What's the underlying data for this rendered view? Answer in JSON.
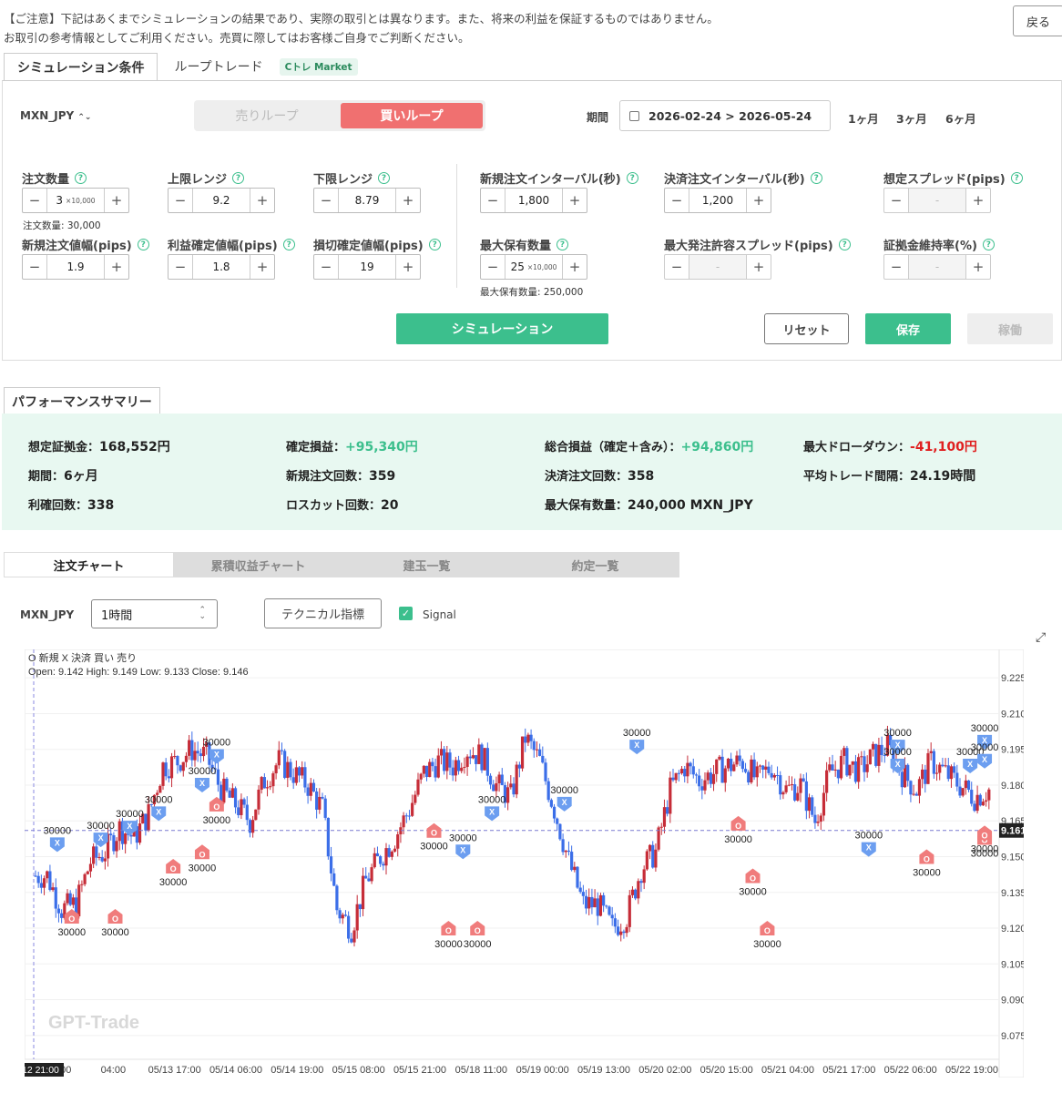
{
  "notice": {
    "line1": "【ご注意】下記はあくまでシミュレーションの結果であり、実際の取引とは異なります。また、将来の利益を保証するものではありません。",
    "line2": "お取引の参考情報としてご利用ください。売買に際してはお客様ご自身でご判断ください。"
  },
  "back_label": "戻る",
  "top_tabs": {
    "conditions": "シミュレーション条件",
    "loop": "ループトレード",
    "ctre": "Cトレ Market"
  },
  "form": {
    "pair": "MXN_JPY",
    "sell_loop": "売りループ",
    "buy_loop": "買いループ",
    "period_label": "期間",
    "date_range": "2026-02-24 > 2026-05-24",
    "ranges": [
      "1ヶ月",
      "3ヶ月",
      "6ヶ月"
    ],
    "fields": {
      "order_qty": {
        "label": "注文数量",
        "value": "3",
        "unit": "×10,000",
        "hint": "注文数量: 30,000"
      },
      "upper": {
        "label": "上限レンジ",
        "value": "9.2"
      },
      "lower": {
        "label": "下限レンジ",
        "value": "8.79"
      },
      "new_interval": {
        "label": "新規注文インターバル(秒)",
        "value": "1,800"
      },
      "close_interval": {
        "label": "決済注文インターバル(秒)",
        "value": "1,200"
      },
      "spread": {
        "label": "想定スプレッド(pips)",
        "value": "-"
      },
      "new_width": {
        "label": "新規注文値幅(pips)",
        "value": "1.9"
      },
      "profit_width": {
        "label": "利益確定値幅(pips)",
        "value": "1.8"
      },
      "stop_width": {
        "label": "損切確定値幅(pips)",
        "value": "19"
      },
      "max_hold": {
        "label": "最大保有数量",
        "value": "25",
        "unit": "×10,000",
        "hint": "最大保有数量: 250,000"
      },
      "max_spread": {
        "label": "最大発注許容スプレッド(pips)",
        "value": "-"
      },
      "margin_rate": {
        "label": "証拠金維持率(%)",
        "value": "-"
      }
    },
    "simulate": "シミュレーション",
    "reset": "リセット",
    "save": "保存",
    "run": "稼働"
  },
  "summary": {
    "tab": "パフォーマンスサマリー",
    "margin_label": "想定証拠金：",
    "margin": "168,552円",
    "realized_label": "確定損益：",
    "realized": "+95,340円",
    "total_label": "総合損益（確定＋含み）：",
    "total": "+94,860円",
    "dd_label": "最大ドローダウン：",
    "dd": "-41,100円",
    "period_label": "期間：",
    "period": "6ヶ月",
    "new_count_label": "新規注文回数：",
    "new_count": "359",
    "close_count_label": "決済注文回数：",
    "close_count": "358",
    "interval_label": "平均トレード間隔：",
    "interval": "24.19時間",
    "win_label": "利確回数：",
    "win": "338",
    "loss_label": "ロスカット回数：",
    "loss": "20",
    "maxhold_label": "最大保有数量：",
    "maxhold": "240,000 MXN_JPY"
  },
  "chart_tabs": [
    "注文チャート",
    "累積収益チャート",
    "建玉一覧",
    "約定一覧"
  ],
  "chart_controls": {
    "pair": "MXN_JPY",
    "timeframe": "1時間",
    "technical": "テクニカル指標",
    "signal": "Signal"
  },
  "chart_data": {
    "type": "candlestick",
    "legend": "O 新規  X 決済  買い  売り",
    "ohlc_readout": "Open: 9.142  High: 9.149  Low: 9.133  Close: 9.146",
    "ylim": [
      9.065,
      9.235
    ],
    "y_ticks": [
      "9.225",
      "9.210",
      "9.195",
      "9.180",
      "9.165",
      "9.150",
      "9.135",
      "9.120",
      "9.105",
      "9.090",
      "9.075"
    ],
    "x_ticks": [
      "12 21:00",
      "04:00",
      "05/13 17:00",
      "05/14 06:00",
      "05/14 19:00",
      "05/15 08:00",
      "05/15 21:00",
      "05/18 11:00",
      "05/19 00:00",
      "05/19 13:00",
      "05/20 02:00",
      "05/20 15:00",
      "05/21 04:00",
      "05/21 17:00",
      "05/22 06:00",
      "05/22 19:00"
    ],
    "current_price": "9.161",
    "watermark": "GPT-Trade",
    "close_path": [
      9.142,
      9.128,
      9.13,
      9.148,
      9.152,
      9.162,
      9.158,
      9.168,
      9.188,
      9.19,
      9.195,
      9.192,
      9.178,
      9.172,
      9.165,
      9.182,
      9.19,
      9.185,
      9.18,
      9.17,
      9.128,
      9.12,
      9.14,
      9.15,
      9.158,
      9.17,
      9.185,
      9.19,
      9.188,
      9.195,
      9.192,
      9.18,
      9.175,
      9.2,
      9.19,
      9.17,
      9.148,
      9.13,
      9.13,
      9.12,
      9.125,
      9.145,
      9.152,
      9.178,
      9.188,
      9.182,
      9.185,
      9.188,
      9.19,
      9.182,
      9.188,
      9.178,
      9.18,
      9.165,
      9.185,
      9.19,
      9.186,
      9.192,
      9.196,
      9.185,
      9.178,
      9.19,
      9.185,
      9.18,
      9.175,
      9.178
    ],
    "signals": [
      {
        "kind": "X",
        "side": "sell",
        "qty": "30000",
        "i": 1,
        "price": 9.155
      },
      {
        "kind": "O",
        "side": "buy",
        "qty": "30000",
        "i": 2,
        "price": 9.125
      },
      {
        "kind": "X",
        "side": "sell",
        "qty": "30000",
        "i": 4,
        "price": 9.157
      },
      {
        "kind": "O",
        "side": "buy",
        "qty": "30000",
        "i": 5,
        "price": 9.125
      },
      {
        "kind": "X",
        "side": "sell",
        "qty": "30000",
        "i": 6,
        "price": 9.162
      },
      {
        "kind": "X",
        "side": "sell",
        "qty": "30000",
        "i": 8,
        "price": 9.168
      },
      {
        "kind": "O",
        "side": "buy",
        "qty": "30000",
        "i": 9,
        "price": 9.146
      },
      {
        "kind": "O",
        "side": "buy",
        "qty": "30000",
        "i": 11,
        "price": 9.152
      },
      {
        "kind": "X",
        "side": "sell",
        "qty": "30000",
        "i": 11,
        "price": 9.18
      },
      {
        "kind": "X",
        "side": "sell",
        "qty": "30000",
        "i": 12,
        "price": 9.192
      },
      {
        "kind": "O",
        "side": "buy",
        "qty": "30000",
        "i": 12,
        "price": 9.172
      },
      {
        "kind": "O",
        "side": "buy",
        "qty": "30000",
        "i": 27,
        "price": 9.161
      },
      {
        "kind": "O",
        "side": "buy",
        "qty": "30000",
        "i": 28,
        "price": 9.12
      },
      {
        "kind": "X",
        "side": "sell",
        "qty": "30000",
        "i": 29,
        "price": 9.152
      },
      {
        "kind": "O",
        "side": "buy",
        "qty": "30000",
        "i": 30,
        "price": 9.12
      },
      {
        "kind": "X",
        "side": "sell",
        "qty": "30000",
        "i": 31,
        "price": 9.168
      },
      {
        "kind": "X",
        "side": "sell",
        "qty": "30000",
        "i": 36,
        "price": 9.172
      },
      {
        "kind": "X",
        "side": "sell",
        "qty": "30000",
        "i": 41,
        "price": 9.196
      },
      {
        "kind": "O",
        "side": "buy",
        "qty": "30000",
        "i": 48,
        "price": 9.164
      },
      {
        "kind": "O",
        "side": "buy",
        "qty": "30000",
        "i": 49,
        "price": 9.142
      },
      {
        "kind": "O",
        "side": "buy",
        "qty": "30000",
        "i": 50,
        "price": 9.12
      },
      {
        "kind": "X",
        "side": "sell",
        "qty": "30000",
        "i": 57,
        "price": 9.153
      },
      {
        "kind": "X",
        "side": "sell",
        "qty": "30000",
        "i": 59,
        "price": 9.196
      },
      {
        "kind": "X",
        "side": "sell",
        "qty": "30000",
        "i": 59,
        "price": 9.188
      },
      {
        "kind": "O",
        "side": "buy",
        "qty": "30000",
        "i": 61,
        "price": 9.15
      },
      {
        "kind": "X",
        "side": "sell",
        "qty": "30000",
        "i": 64,
        "price": 9.188
      },
      {
        "kind": "O",
        "side": "buy",
        "qty": "30000",
        "i": 65,
        "price": 9.158
      },
      {
        "kind": "X",
        "side": "sell",
        "qty": "30000",
        "i": 68,
        "price": 9.198
      },
      {
        "kind": "O",
        "side": "buy",
        "qty": "30000",
        "i": 72,
        "price": 9.16
      },
      {
        "kind": "X",
        "side": "sell",
        "qty": "30000",
        "i": 73,
        "price": 9.19
      }
    ]
  }
}
